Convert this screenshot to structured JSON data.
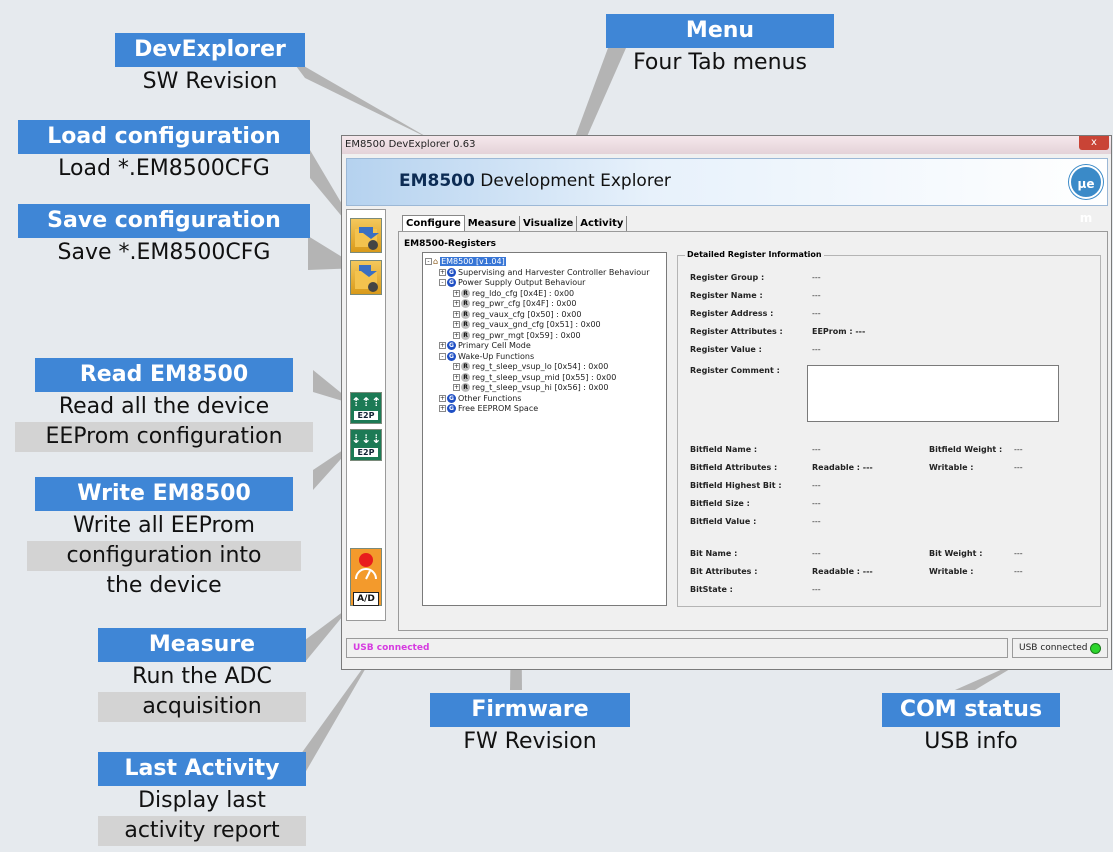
{
  "callouts": {
    "devexplorer": {
      "title": "DevExplorer",
      "lines": [
        "SW Revision"
      ]
    },
    "load": {
      "title": "Load configuration",
      "lines": [
        "Load *.EM8500CFG"
      ]
    },
    "save": {
      "title": "Save configuration",
      "lines": [
        "Save *.EM8500CFG"
      ]
    },
    "read": {
      "title": "Read EM8500",
      "lines": [
        "Read all the device",
        "EEProm configuration"
      ]
    },
    "write": {
      "title": "Write EM8500",
      "lines": [
        "Write all EEProm",
        "configuration into",
        "the device"
      ]
    },
    "measure": {
      "title": "Measure",
      "lines": [
        "Run the ADC",
        "acquisition"
      ]
    },
    "activity": {
      "title": "Last Activity",
      "lines": [
        "Display last",
        "activity report"
      ]
    },
    "menu": {
      "title": "Menu",
      "lines": [
        "Four Tab menus"
      ]
    },
    "firmware": {
      "title": "Firmware",
      "lines": [
        "FW Revision"
      ]
    },
    "com": {
      "title": "COM status",
      "lines": [
        "USB info"
      ]
    }
  },
  "window": {
    "title": "EM8500 DevExplorer 0.63",
    "close": "x",
    "banner_bold": "EM8500",
    "banner_rest": " Development Explorer",
    "logo": "μe m"
  },
  "leftbar": {
    "e2p": "E2P",
    "ad": "A/D"
  },
  "tabs": [
    "Configure",
    "Measure",
    "Visualize",
    "Activity"
  ],
  "registers_group": "EM8500-Registers",
  "tree": [
    {
      "pm": "-",
      "icon": "house",
      "label": "EM8500 [v1.04]",
      "indent": 0,
      "selected": true
    },
    {
      "pm": "+",
      "icon": "G",
      "label": "Supervising and Harvester Controller Behaviour",
      "indent": 1
    },
    {
      "pm": "-",
      "icon": "G",
      "label": "Power Supply Output Behaviour",
      "indent": 1
    },
    {
      "pm": "+",
      "icon": "R",
      "label": "reg_ldo_cfg [0x4E] : 0x00",
      "indent": 2
    },
    {
      "pm": "+",
      "icon": "R",
      "label": "reg_pwr_cfg [0x4F] : 0x00",
      "indent": 2
    },
    {
      "pm": "+",
      "icon": "R",
      "label": "reg_vaux_cfg [0x50] : 0x00",
      "indent": 2
    },
    {
      "pm": "+",
      "icon": "R",
      "label": "reg_vaux_gnd_cfg [0x51] : 0x00",
      "indent": 2
    },
    {
      "pm": "+",
      "icon": "R",
      "label": "reg_pwr_mgt [0x59] : 0x00",
      "indent": 2
    },
    {
      "pm": "+",
      "icon": "G",
      "label": "Primary Cell Mode",
      "indent": 1
    },
    {
      "pm": "-",
      "icon": "G",
      "label": "Wake-Up Functions",
      "indent": 1
    },
    {
      "pm": "+",
      "icon": "R",
      "label": "reg_t_sleep_vsup_lo [0x54] : 0x00",
      "indent": 2
    },
    {
      "pm": "+",
      "icon": "R",
      "label": "reg_t_sleep_vsup_mid [0x55] : 0x00",
      "indent": 2
    },
    {
      "pm": "+",
      "icon": "R",
      "label": "reg_t_sleep_vsup_hi [0x56] : 0x00",
      "indent": 2
    },
    {
      "pm": "+",
      "icon": "G",
      "label": "Other Functions",
      "indent": 1
    },
    {
      "pm": "+",
      "icon": "G",
      "label": "Free EEPROM Space",
      "indent": 1
    }
  ],
  "detail": {
    "title": "Detailed Register Information",
    "register_group": {
      "label": "Register Group :",
      "value": "---"
    },
    "register_name": {
      "label": "Register Name :",
      "value": "---"
    },
    "register_address": {
      "label": "Register Address :",
      "value": "---"
    },
    "register_attributes": {
      "label": "Register Attributes :",
      "value": "EEProm :  ---"
    },
    "register_value": {
      "label": "Register Value :",
      "value": "---"
    },
    "register_comment": {
      "label": "Register Comment :"
    },
    "bitfield_name": {
      "label": "Bitfield Name :",
      "value": "---"
    },
    "bitfield_weight": {
      "label": "Bitfield Weight :",
      "value": "---"
    },
    "bitfield_attributes": {
      "label": "Bitfield Attributes :",
      "value": "Readable : ---"
    },
    "bitfield_writable": {
      "label": "Writable :",
      "value": "---"
    },
    "bitfield_highest": {
      "label": "Bitfield Highest Bit :",
      "value": "---"
    },
    "bitfield_size": {
      "label": "Bitfield Size :",
      "value": "---"
    },
    "bitfield_value": {
      "label": "Bitfield Value :",
      "value": "---"
    },
    "bit_name": {
      "label": "Bit Name :",
      "value": "---"
    },
    "bit_weight": {
      "label": "Bit Weight :",
      "value": "---"
    },
    "bit_attributes": {
      "label": "Bit Attributes :",
      "value": "Readable : ---"
    },
    "bit_writable": {
      "label": "Writable :",
      "value": "---"
    },
    "bit_state": {
      "label": "BitState :",
      "value": "---"
    }
  },
  "status": {
    "left": "USB connected",
    "right": "USB connected",
    "led_color": "#2cd42c"
  },
  "colors": {
    "callout_blue": "#3f86d6",
    "callout_gray": "#d3d3d3"
  }
}
